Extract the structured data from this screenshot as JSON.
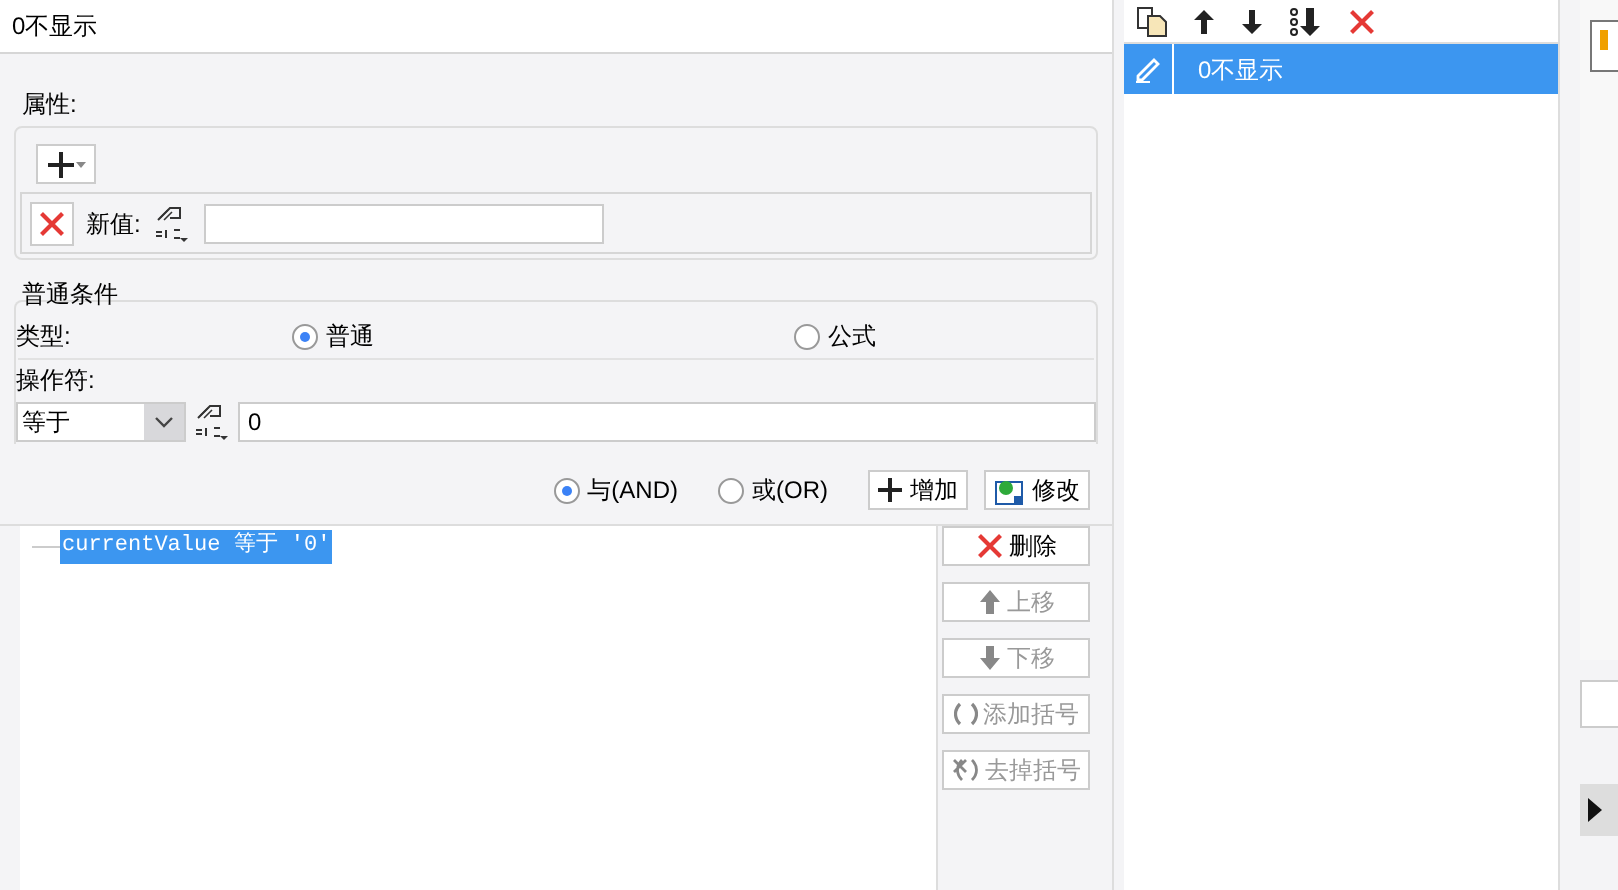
{
  "header": {
    "title": "0不显示"
  },
  "properties": {
    "legend": "属性:",
    "new_value_label": "新值:"
  },
  "condition": {
    "legend": "普通条件",
    "type_label": "类型:",
    "type_options": [
      {
        "label": "普通",
        "selected": true
      },
      {
        "label": "公式",
        "selected": false
      }
    ],
    "operator_label": "操作符:",
    "operator": "等于",
    "value": "0"
  },
  "logic_options": [
    {
      "label": "与(AND)",
      "selected": true
    },
    {
      "label": "或(OR)",
      "selected": false
    }
  ],
  "actions": [
    {
      "label": "增加",
      "kind": "add"
    },
    {
      "label": "修改",
      "kind": "edit"
    }
  ],
  "tree": [
    {
      "label": "currentValue 等于 '0'",
      "selected": true
    }
  ],
  "side_buttons": [
    {
      "label": "删除",
      "kind": "delete",
      "disabled": false
    },
    {
      "label": "上移",
      "kind": "up",
      "disabled": true
    },
    {
      "label": "下移",
      "kind": "down",
      "disabled": true
    },
    {
      "label": "添加括号",
      "kind": "add-brackets",
      "disabled": true
    },
    {
      "label": "去掉括号",
      "kind": "remove-brackets",
      "disabled": true
    }
  ],
  "list_items": [
    {
      "label": "0不显示",
      "selected": true
    }
  ]
}
